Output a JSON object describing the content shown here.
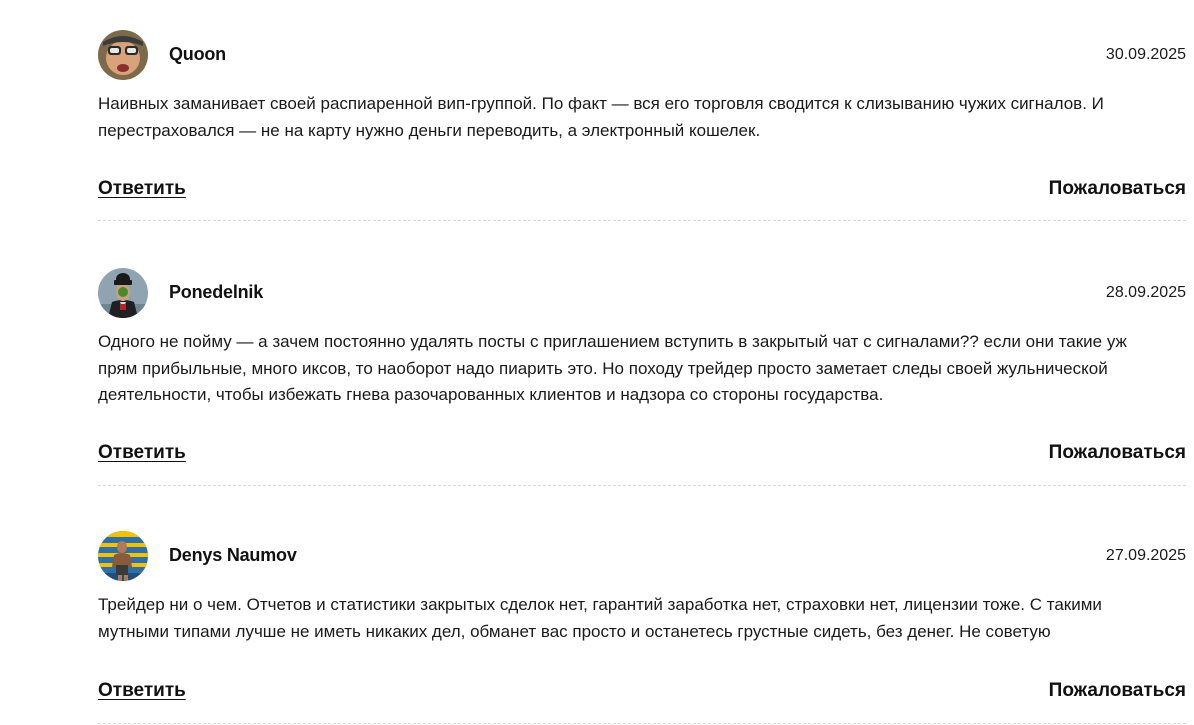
{
  "comments": [
    {
      "author": "Quoon",
      "date": "30.09.2025",
      "text": "Наивных заманивает своей распиаренной вип-группой. По факт — вся его торговля сводится к слизыванию чужих сигналов. И перестраховался — не на карту нужно деньги переводить, а электронный кошелек.",
      "reply_label": "Ответить",
      "complain_label": "Пожаловаться"
    },
    {
      "author": "Ponedelnik",
      "date": "28.09.2025",
      "text": "Одного не пойму — а зачем постоянно удалять посты с приглашением вступить в закрытый чат с сигналами?? если они такие уж прям прибыльные, много иксов, то наоборот надо пиарить это. Но походу трейдер просто заметает следы своей жульнической деятельности, чтобы избежать гнева разочарованных клиентов и надзора со стороны государства.",
      "reply_label": "Ответить",
      "complain_label": "Пожаловаться"
    },
    {
      "author": "Denys Naumov",
      "date": "27.09.2025",
      "text": "Трейдер ни о чем. Отчетов и статистики закрытых сделок нет, гарантий заработка нет, страховки нет, лицензии тоже. С такими мутными типами лучше не иметь никаких дел, обманет вас просто и останетесь грустные сидеть, без денег. Не советую",
      "reply_label": "Ответить",
      "complain_label": "Пожаловаться"
    }
  ]
}
